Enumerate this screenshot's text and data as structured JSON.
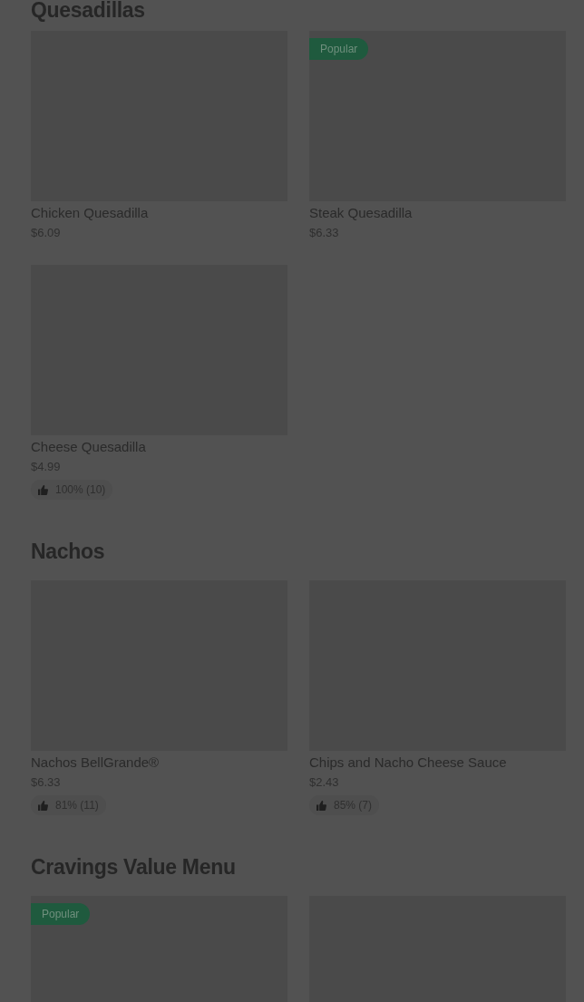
{
  "sections": [
    {
      "title": "Quesadillas",
      "items": [
        {
          "name": "Chicken Quesadilla",
          "price": "$6.09"
        },
        {
          "name": "Steak Quesadilla",
          "price": "$6.33",
          "badge": "Popular"
        },
        {
          "name": "Cheese Quesadilla",
          "price": "$4.99",
          "rating": "100% (10)"
        }
      ]
    },
    {
      "title": "Nachos",
      "items": [
        {
          "name": "Nachos BellGrande®",
          "price": "$6.33",
          "rating": "81% (11)"
        },
        {
          "name": "Chips and Nacho Cheese Sauce",
          "price": "$2.43",
          "rating": "85% (7)"
        }
      ]
    },
    {
      "title": "Cravings Value Menu",
      "items": [
        {
          "kind": "picture",
          "badge": "Popular"
        },
        {
          "kind": "picture"
        }
      ]
    }
  ]
}
